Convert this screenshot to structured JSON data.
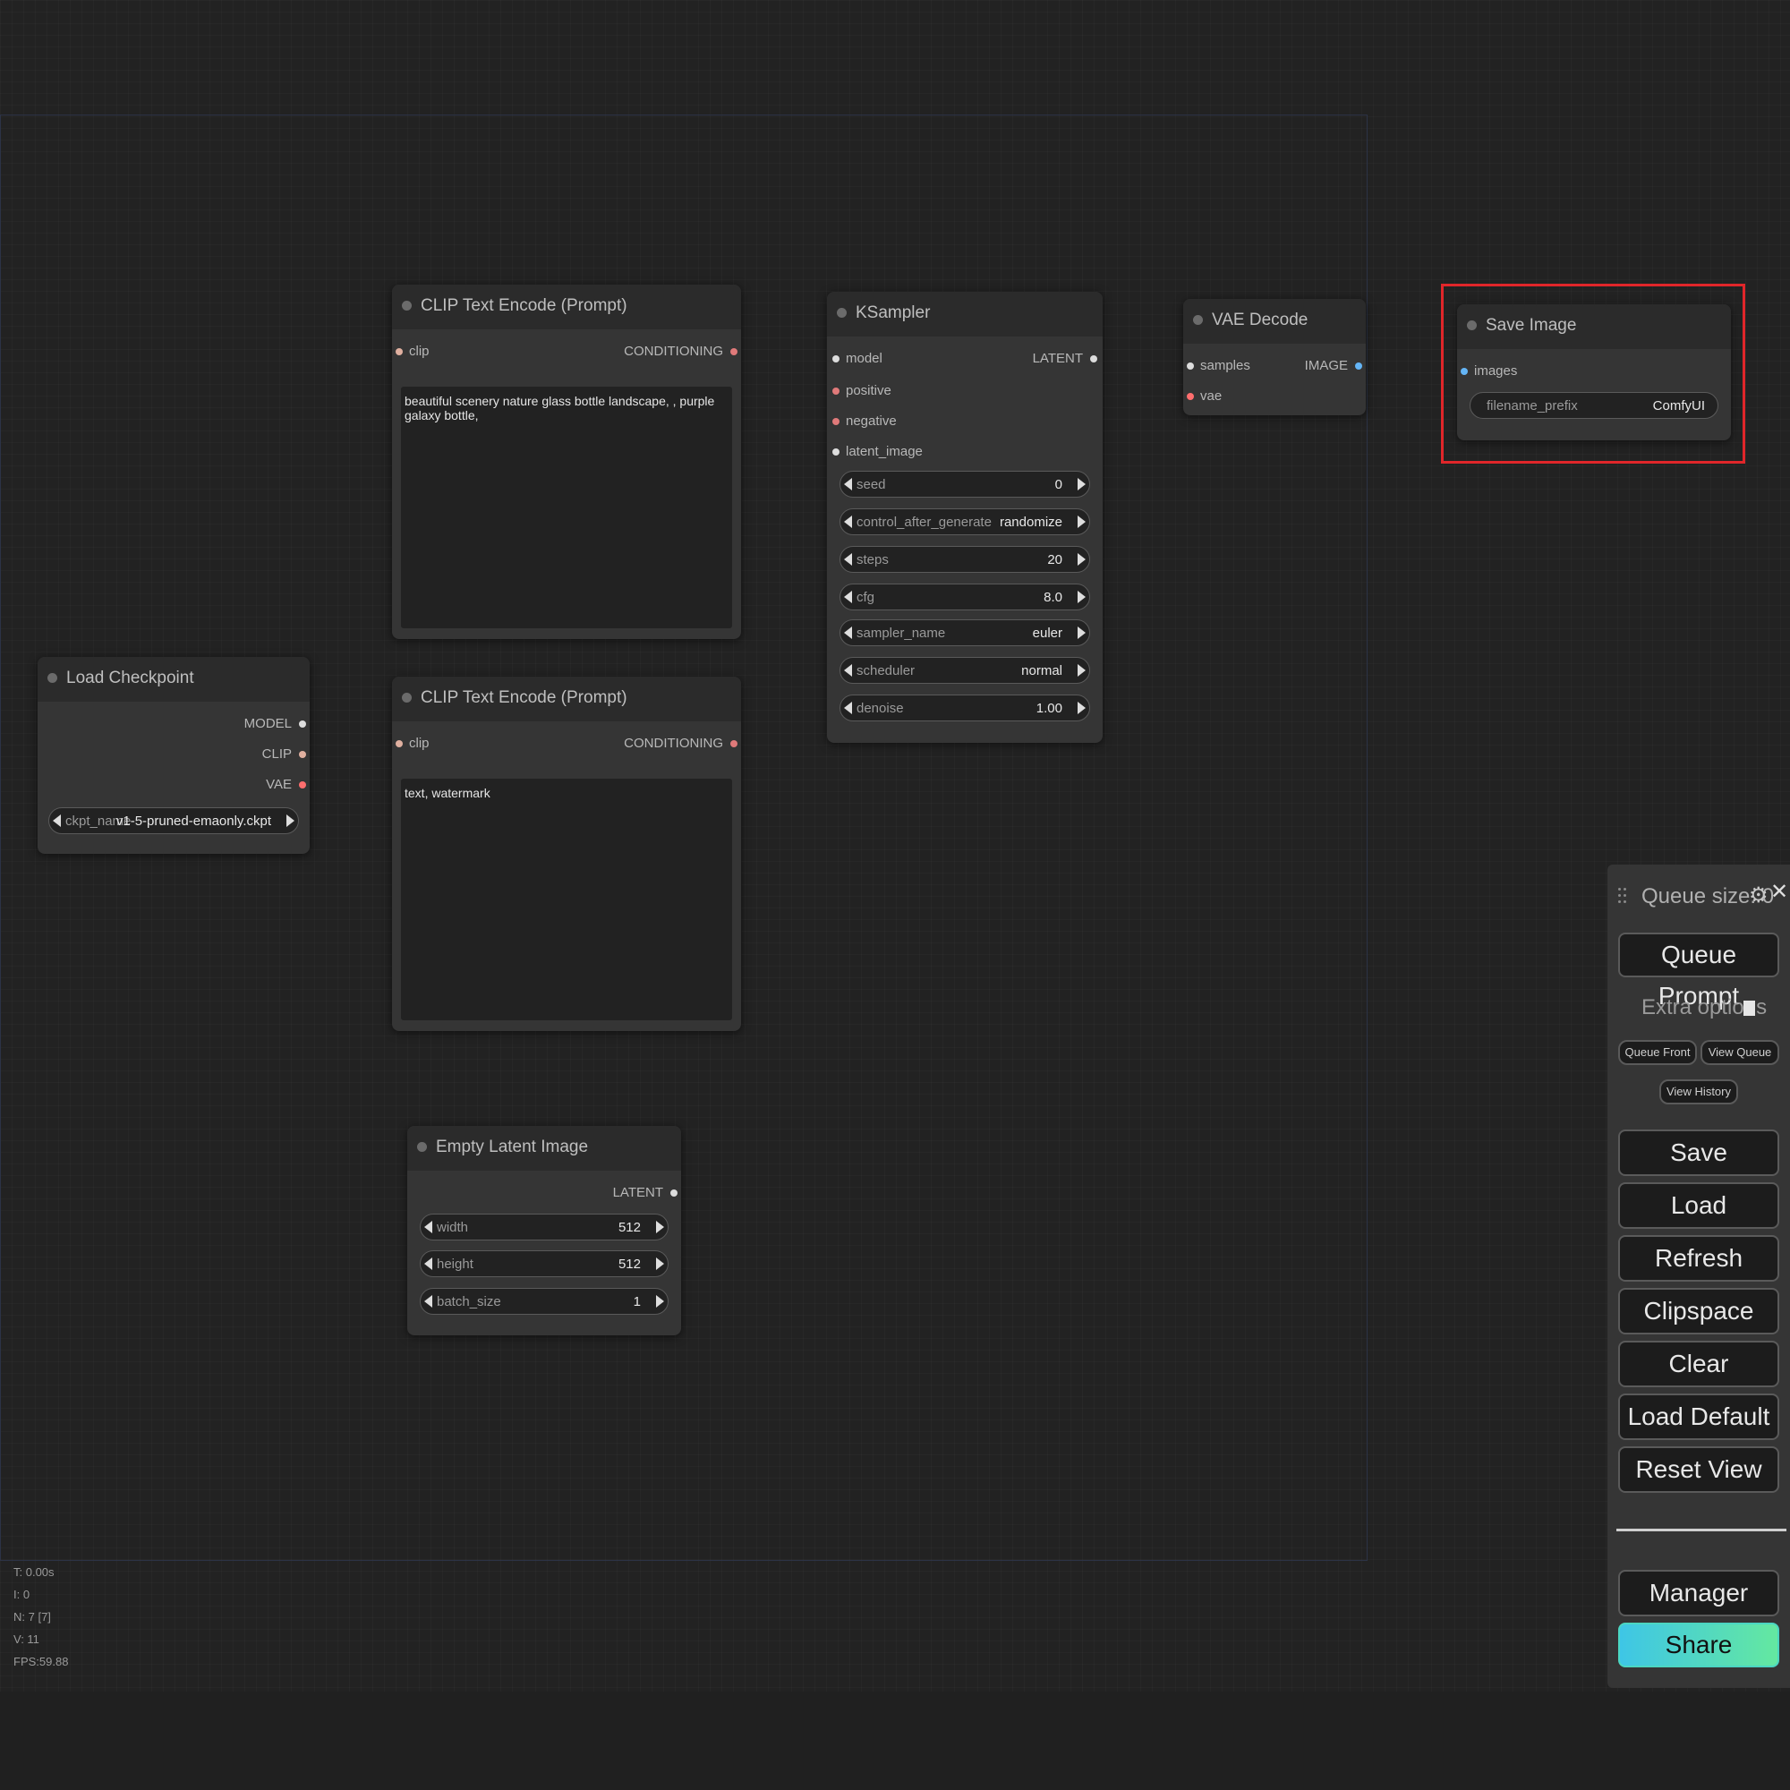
{
  "nodes": {
    "clip_pos": {
      "title": "CLIP Text Encode (Prompt)",
      "input": "clip",
      "output": "CONDITIONING",
      "text": "beautiful scenery nature glass bottle landscape, , purple galaxy bottle,"
    },
    "clip_neg": {
      "title": "CLIP Text Encode (Prompt)",
      "input": "clip",
      "output": "CONDITIONING",
      "text": "text, watermark"
    },
    "ksampler": {
      "title": "KSampler",
      "inputs": [
        "model",
        "positive",
        "negative",
        "latent_image"
      ],
      "output": "LATENT",
      "widgets": [
        {
          "label": "seed",
          "value": "0"
        },
        {
          "label": "control_after_generate",
          "value": "randomize"
        },
        {
          "label": "steps",
          "value": "20"
        },
        {
          "label": "cfg",
          "value": "8.0"
        },
        {
          "label": "sampler_name",
          "value": "euler"
        },
        {
          "label": "scheduler",
          "value": "normal"
        },
        {
          "label": "denoise",
          "value": "1.00"
        }
      ]
    },
    "vae_decode": {
      "title": "VAE Decode",
      "inputs": [
        "samples",
        "vae"
      ],
      "output": "IMAGE"
    },
    "save_image": {
      "title": "Save Image",
      "input": "images",
      "widget": {
        "label": "filename_prefix",
        "value": "ComfyUI"
      }
    },
    "load_checkpoint": {
      "title": "Load Checkpoint",
      "outputs": [
        "MODEL",
        "CLIP",
        "VAE"
      ],
      "widget": {
        "label": "ckpt_name",
        "value": "v1-5-pruned-emaonly.ckpt"
      }
    },
    "empty_latent": {
      "title": "Empty Latent Image",
      "output": "LATENT",
      "widgets": [
        {
          "label": "width",
          "value": "512"
        },
        {
          "label": "height",
          "value": "512"
        },
        {
          "label": "batch_size",
          "value": "1"
        }
      ]
    }
  },
  "stats": [
    "T: 0.00s",
    "I: 0",
    "N: 7 [7]",
    "V: 11",
    "FPS:59.88"
  ],
  "panel": {
    "queue_size": "Queue size: 0",
    "queue_prompt": "Queue Prompt",
    "extra_options": "Extra options",
    "queue_front": "Queue Front",
    "view_queue": "View Queue",
    "view_history": "View History",
    "save": "Save",
    "load": "Load",
    "refresh": "Refresh",
    "clipspace": "Clipspace",
    "clear": "Clear",
    "load_default": "Load Default",
    "reset_view": "Reset View",
    "manager": "Manager",
    "share": "Share"
  },
  "colors": {
    "canvas": "#222222",
    "node_body": "#353535",
    "node_title": "#2b2b2b",
    "pin_clip": "#e0b0a0",
    "pin_conditioning": "#e07a7a",
    "pin_image": "#64b5f6",
    "pin_vae": "#ff6e6e",
    "pin_generic": "#dddddd",
    "highlight": "#e0262a"
  }
}
